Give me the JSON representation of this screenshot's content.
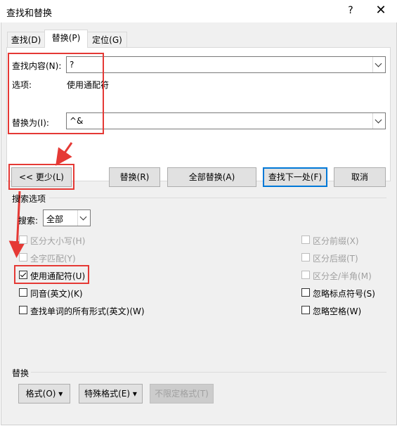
{
  "window": {
    "title": "查找和替换",
    "help_glyph": "?",
    "close_glyph": "✕"
  },
  "tabs": [
    {
      "label": "查找(D)",
      "active": false
    },
    {
      "label": "替换(P)",
      "active": true
    },
    {
      "label": "定位(G)",
      "active": false
    }
  ],
  "find": {
    "label": "查找内容(N):",
    "value": "?",
    "options_label": "选项:",
    "options_value": "使用通配符"
  },
  "replace": {
    "label": "替换为(I):",
    "value": "^&"
  },
  "buttons": {
    "less": "<< 更少(L)",
    "replace": "替换(R)",
    "replace_all": "全部替换(A)",
    "find_next": "查找下一处(F)",
    "cancel": "取消"
  },
  "search_options": {
    "section_title": "搜索选项",
    "search_label": "搜索:",
    "search_value": "全部",
    "left_checks": [
      {
        "label": "区分大小写(H)",
        "checked": false,
        "enabled": false
      },
      {
        "label": "全字匹配(Y)",
        "checked": false,
        "enabled": false
      },
      {
        "label": "使用通配符(U)",
        "checked": true,
        "enabled": true
      },
      {
        "label": "同音(英文)(K)",
        "checked": false,
        "enabled": true
      },
      {
        "label": "查找单词的所有形式(英文)(W)",
        "checked": false,
        "enabled": true
      }
    ],
    "right_checks": [
      {
        "label": "区分前缀(X)",
        "checked": false,
        "enabled": false
      },
      {
        "label": "区分后缀(T)",
        "checked": false,
        "enabled": false
      },
      {
        "label": "区分全/半角(M)",
        "checked": false,
        "enabled": false
      },
      {
        "label": "忽略标点符号(S)",
        "checked": false,
        "enabled": true
      },
      {
        "label": "忽略空格(W)",
        "checked": false,
        "enabled": true
      }
    ]
  },
  "replace_section": {
    "title": "替换",
    "format_button": "格式(O) ▾",
    "special_button": "特殊格式(E) ▾",
    "no_format_button": "不限定格式(T)"
  },
  "colors": {
    "highlight": "#e53935",
    "focus": "#0078d7",
    "dialog_bg": "#f0f0f0"
  }
}
